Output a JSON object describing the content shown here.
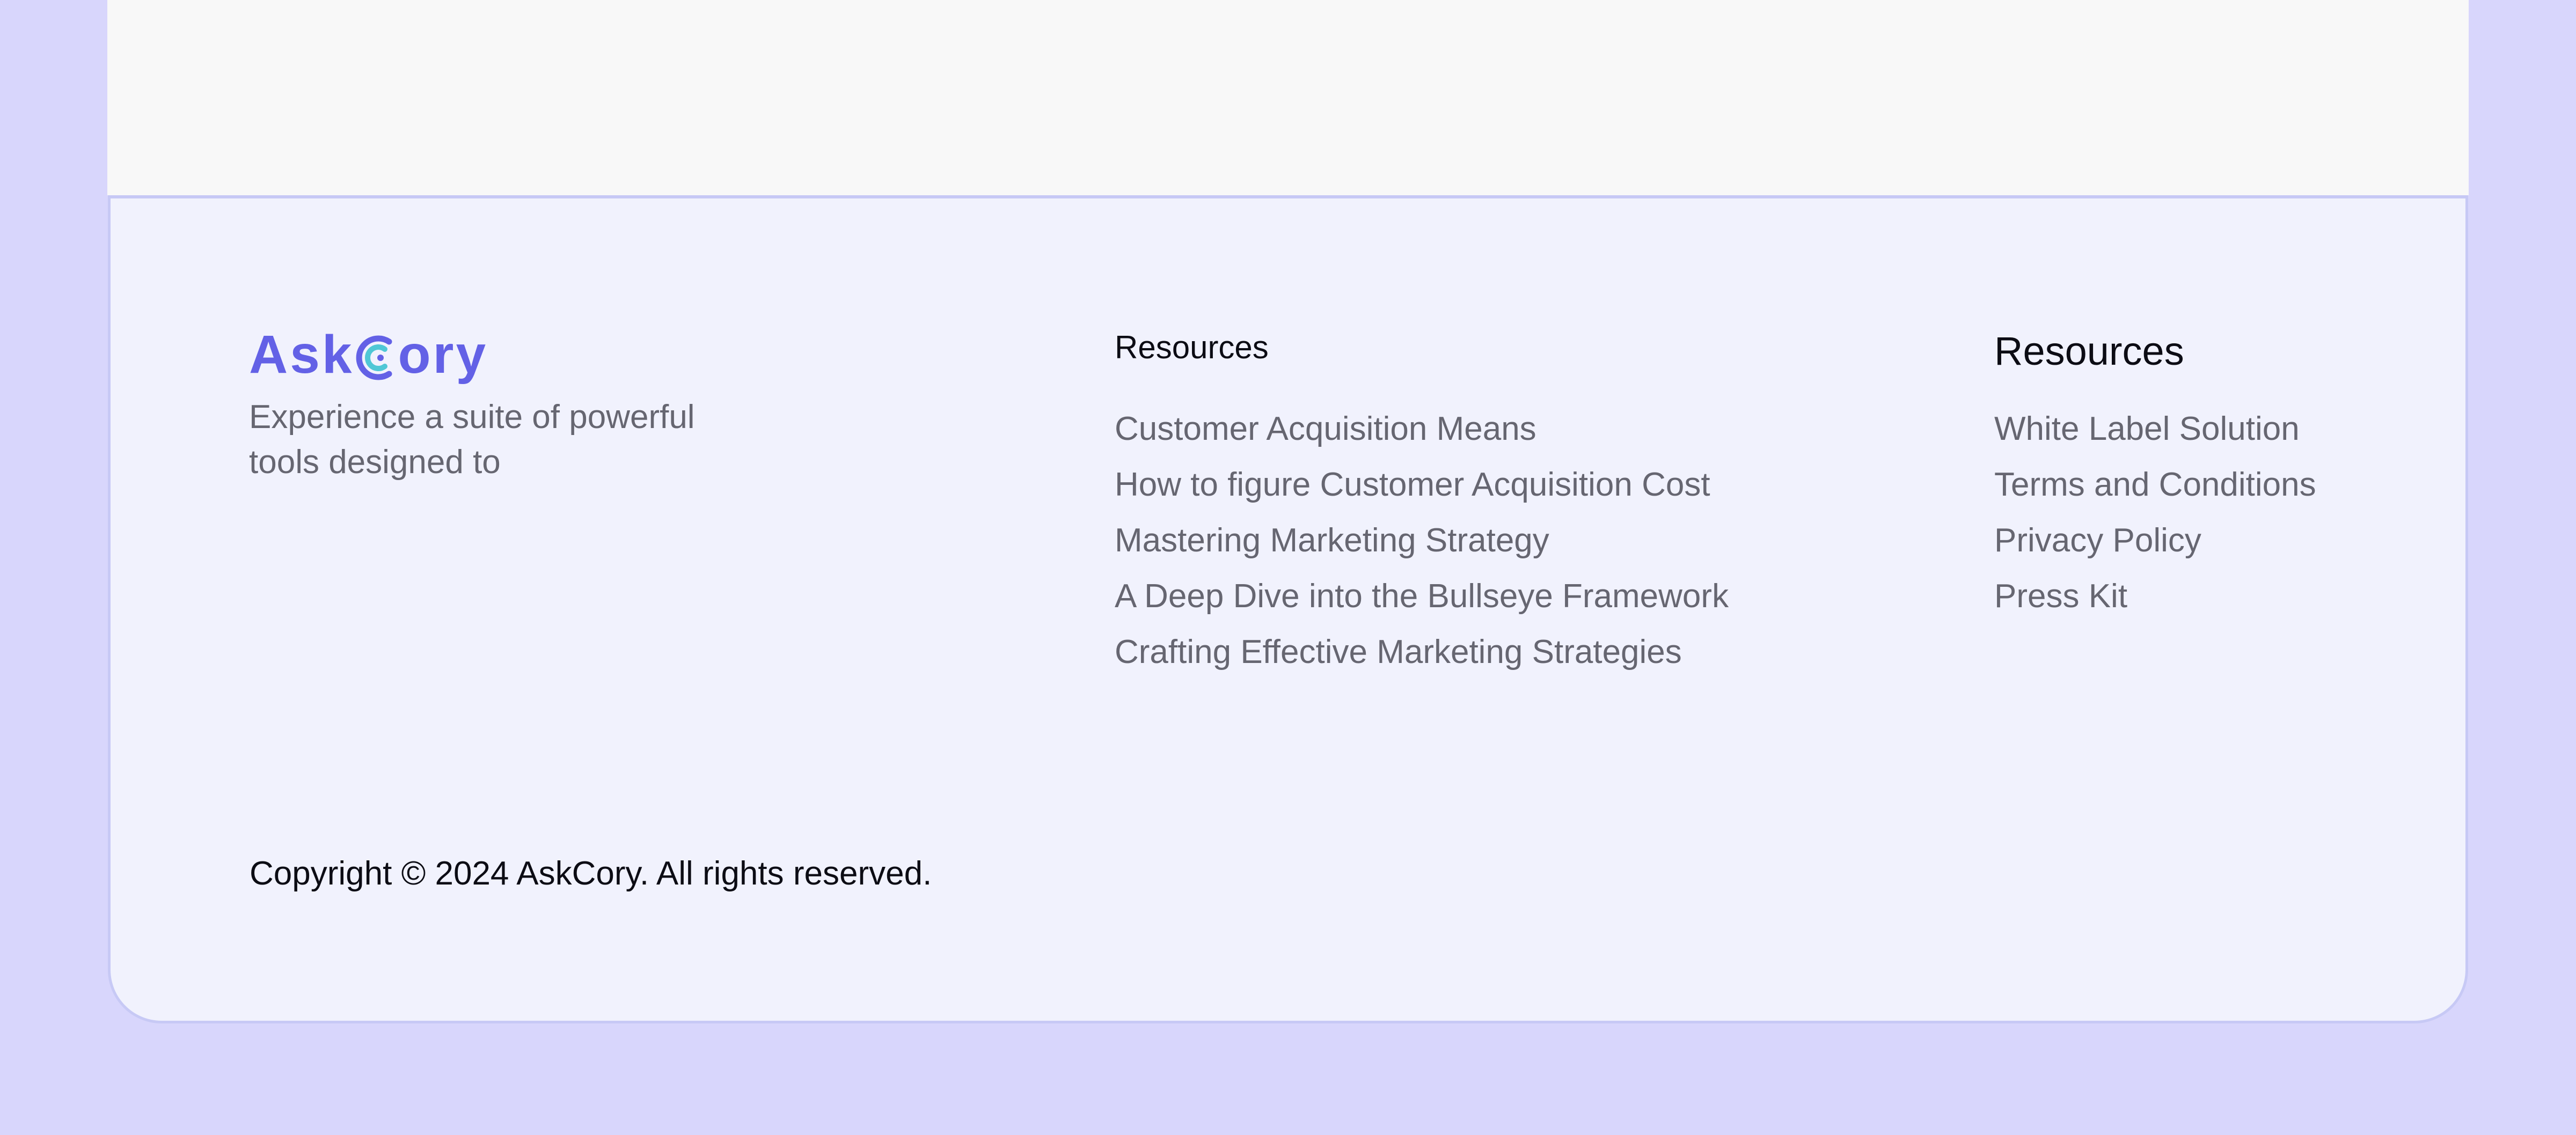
{
  "brand": {
    "logo_prefix": "Ask",
    "logo_suffix": "ory",
    "tagline": "Experience a suite of powerful tools designed to",
    "colors": {
      "logo": "#6361e6",
      "logo_accent": "#4fc7d6"
    }
  },
  "footer": {
    "columns": [
      {
        "title": "Resources",
        "links": [
          "Customer Acquisition Means",
          "How to figure Customer Acquisition Cost",
          "Mastering Marketing Strategy",
          "A Deep Dive into the Bullseye Framework",
          "Crafting Effective Marketing Strategies"
        ]
      },
      {
        "title": "Resources",
        "links": [
          "White Label Solution",
          "Terms and Conditions",
          "Privacy Policy",
          "Press Kit"
        ]
      }
    ],
    "copyright": "Copyright © 2024 AskCory. All rights reserved."
  },
  "colors": {
    "page_background": "#d8d6fc",
    "footer_background": "#f1f2fd",
    "footer_border": "#c7c9f5",
    "link_text": "#666671",
    "heading_text": "#0c0c14"
  }
}
